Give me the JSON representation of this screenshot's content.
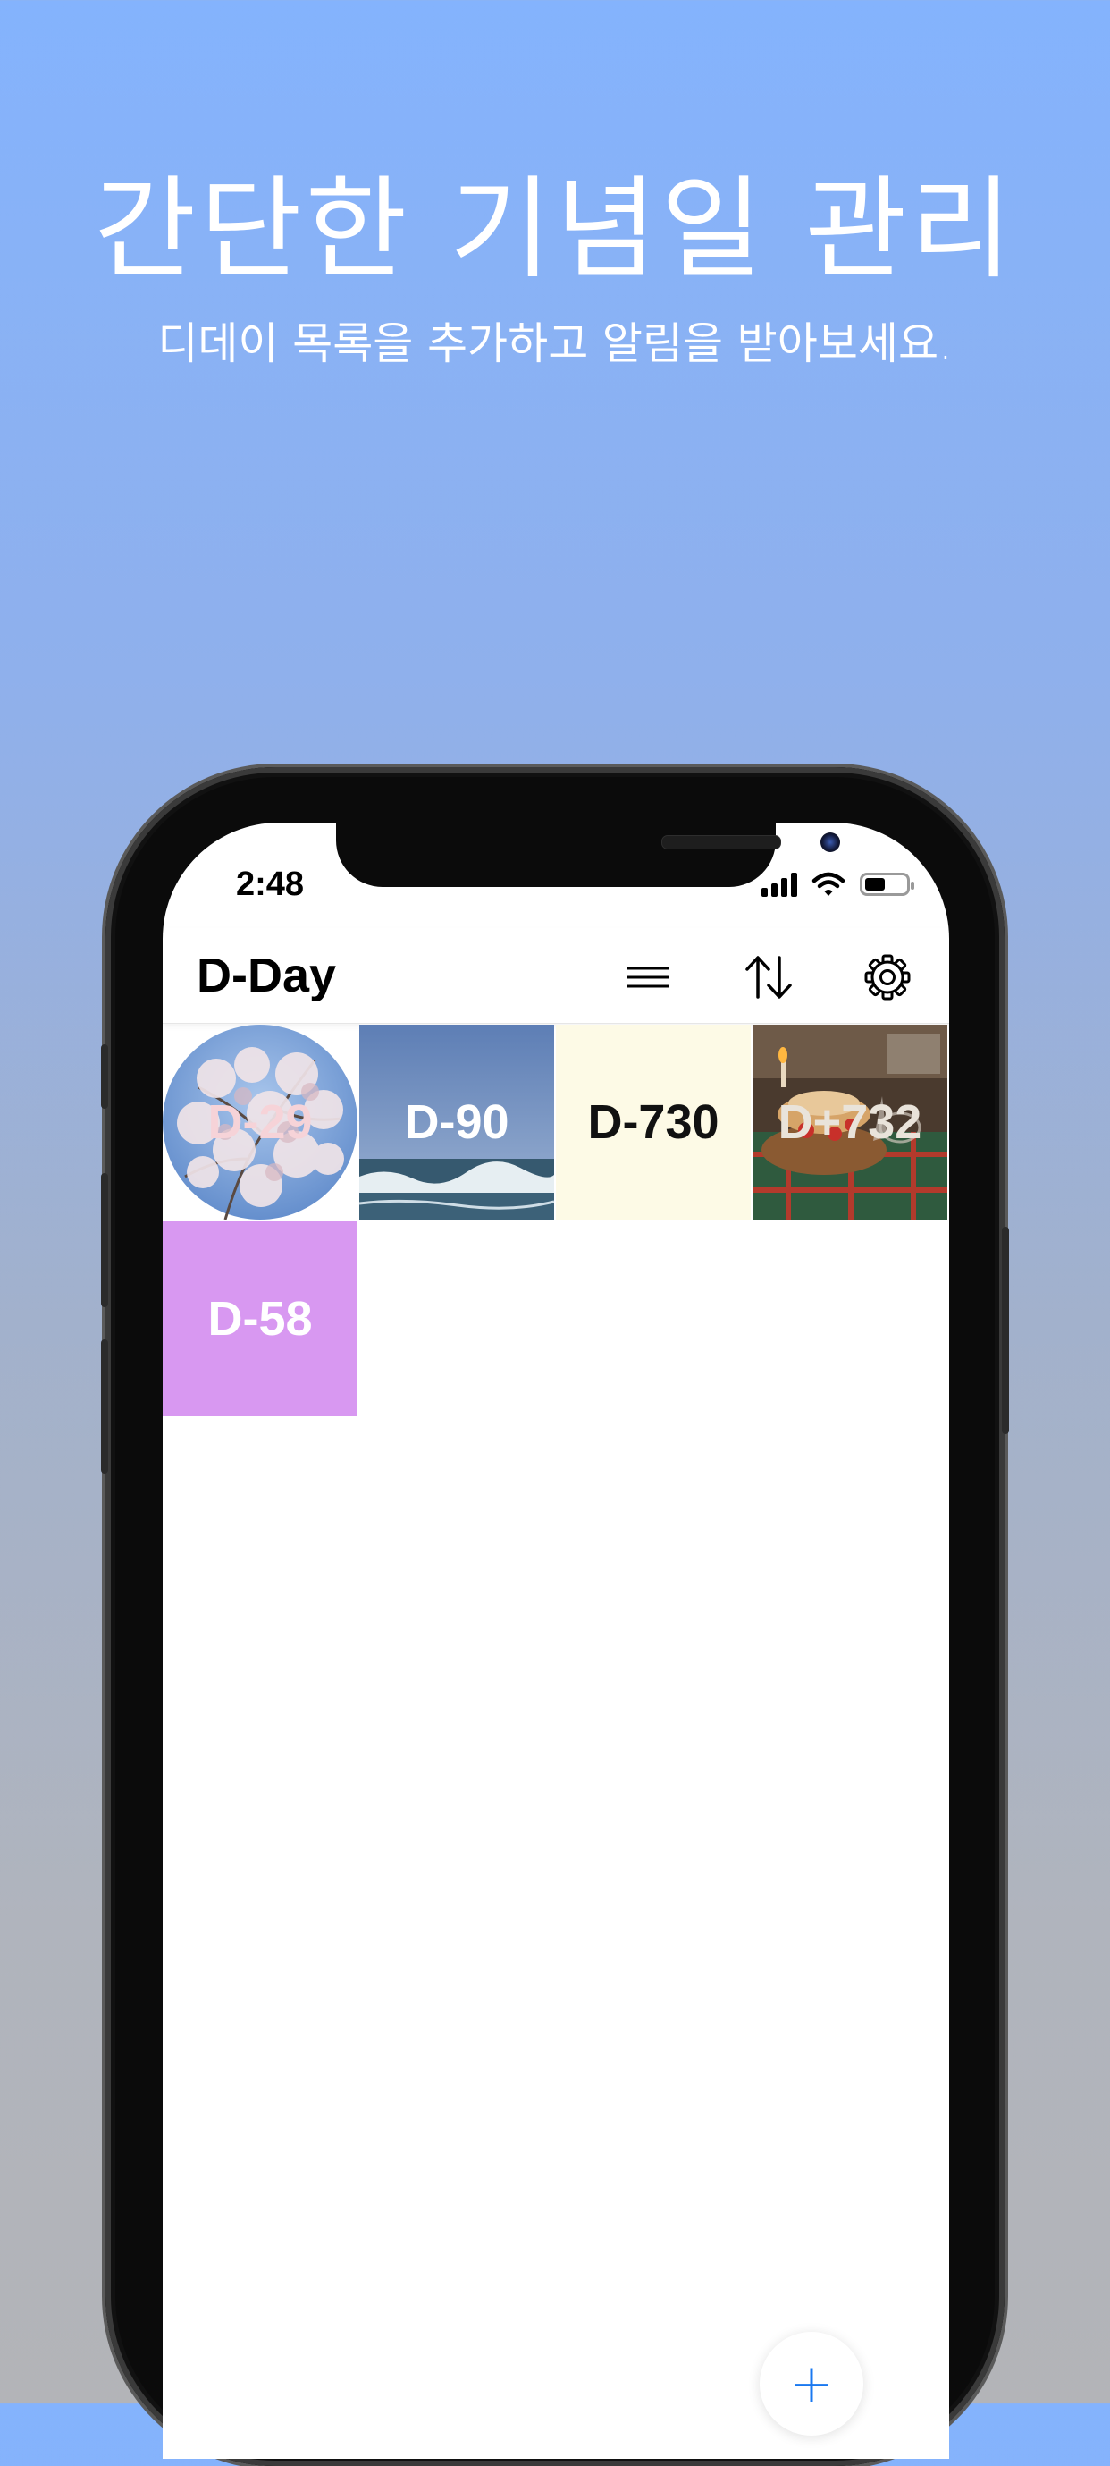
{
  "promo": {
    "headline": "간단한 기념일 관리",
    "subline": "디데이 목록을 추가하고 알림을 받아보세요."
  },
  "status_bar": {
    "time": "2:48",
    "signal_icon": "cellular-signal-icon",
    "wifi_icon": "wifi-icon",
    "battery_icon": "battery-icon",
    "battery_level": 0.5
  },
  "navbar": {
    "title": "D-Day",
    "menu_icon": "hamburger-menu-icon",
    "sort_icon": "sort-arrows-icon",
    "settings_icon": "gear-icon"
  },
  "dday_items": [
    {
      "label": "D-29",
      "background": "cherry-blossom-photo",
      "shape": "circle",
      "text_color": "#f6d3d8"
    },
    {
      "label": "D-90",
      "background": "ocean-wave-photo",
      "shape": "square",
      "text_color": "#ffffff"
    },
    {
      "label": "D-730",
      "background": "#fdfae6",
      "shape": "square",
      "text_color": "#111111"
    },
    {
      "label": "D+732",
      "background": "cake-table-photo",
      "shape": "square",
      "text_color": "#e9e3da"
    },
    {
      "label": "D-58",
      "background": "#d898f1",
      "shape": "square",
      "text_color": "#ffffff"
    }
  ],
  "fab": {
    "label": "+",
    "icon": "plus-icon"
  },
  "colors": {
    "accent": "#1a78f0",
    "gradient_top": "#84b3fd",
    "gradient_bottom": "#b3b4b8"
  }
}
